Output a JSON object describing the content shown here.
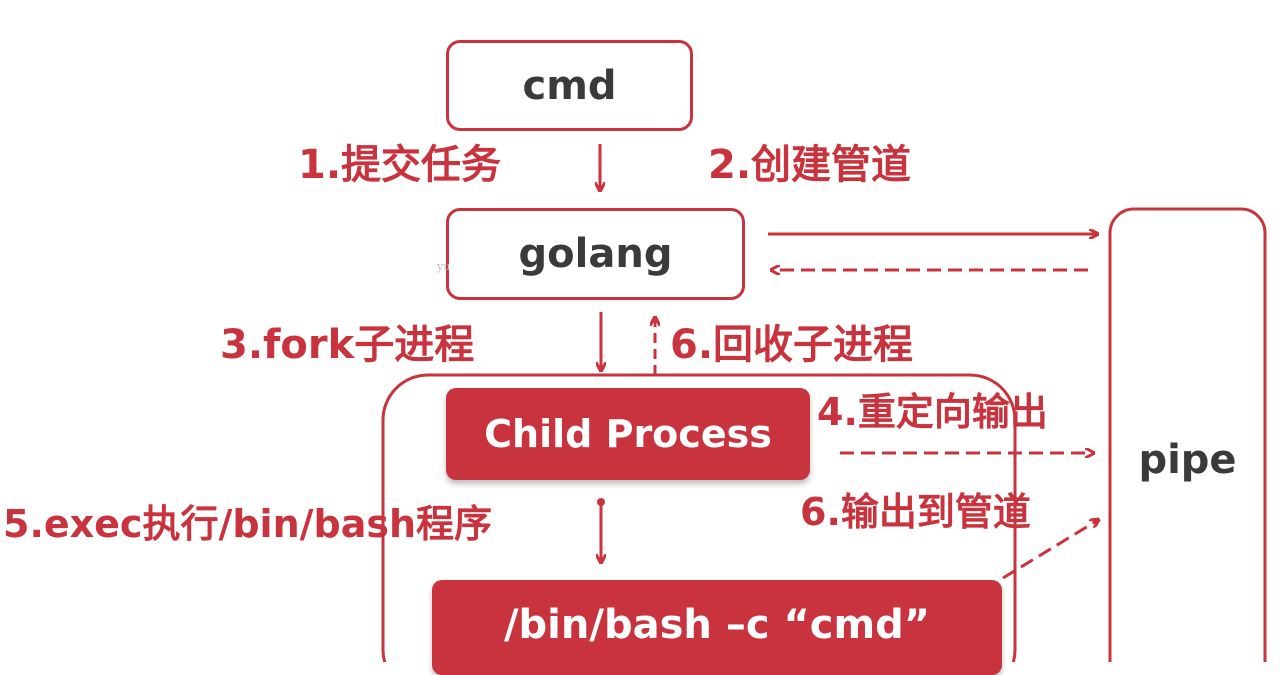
{
  "colors": {
    "accent": "#c8333d",
    "text": "#3a3a3a"
  },
  "nodes": {
    "cmd": "cmd",
    "golang": "golang",
    "child": "Child Process",
    "bash": "/bin/bash –c  “cmd”",
    "pipe": "pipe"
  },
  "steps": {
    "s1": "1.提交任务",
    "s2": "2.创建管道",
    "s3": "3.fork子进程",
    "s4": "4.重定向输出",
    "s5": "5.exec执行/bin/bash程序",
    "s6a": "6.回收子进程",
    "s6b": "6.输出到管道"
  },
  "stamp": "yu"
}
